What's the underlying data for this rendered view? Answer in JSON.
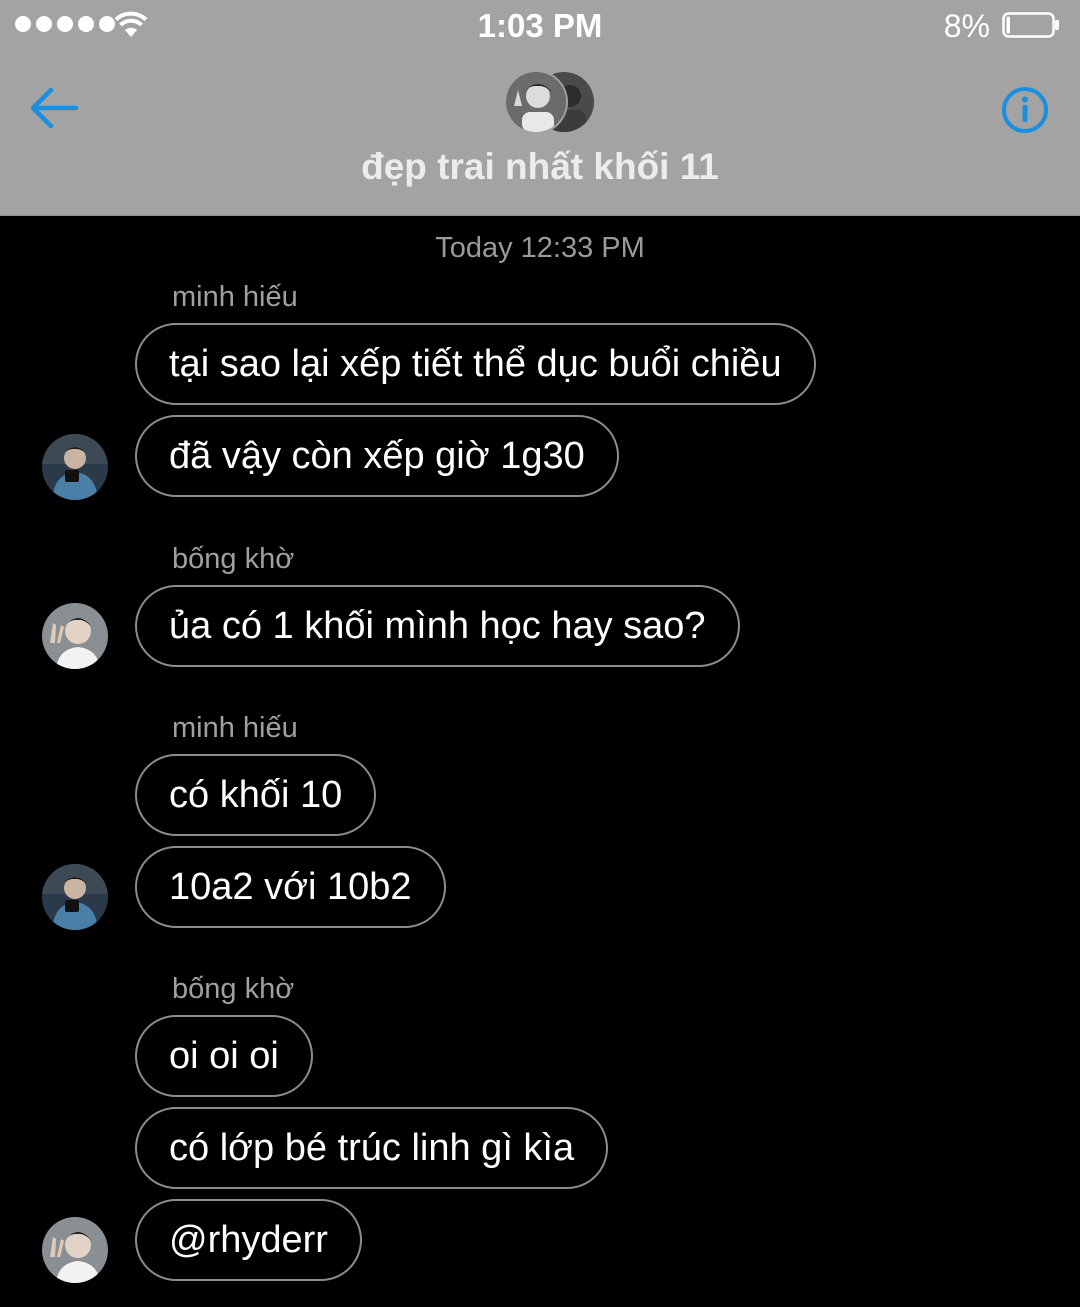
{
  "status_bar": {
    "time": "1:03 PM",
    "battery_percent": "8%",
    "battery_level": 0.08,
    "signal_dots": 5,
    "wifi_icon": "wifi-icon",
    "battery_icon": "battery-icon"
  },
  "nav": {
    "title": "đẹp trai nhất khối 11",
    "back_icon": "arrow-left-icon",
    "info_icon": "info-icon",
    "accent_color": "#1a8fe0"
  },
  "conversation": {
    "timestamp": "Today 12:33 PM",
    "groups": [
      {
        "sender": "minh hiếu",
        "messages": [
          "tại sao lại xếp tiết thể dục buổi chiều",
          "đã vậy còn xếp giờ 1g30"
        ]
      },
      {
        "sender": "bống khờ",
        "messages": [
          "ủa có 1 khối mình học hay sao?"
        ]
      },
      {
        "sender": "minh hiếu",
        "messages": [
          "có khối 10",
          "10a2 với 10b2"
        ]
      },
      {
        "sender": "bống khờ",
        "messages": [
          "oi oi oi",
          "có lớp bé trúc linh gì kìa",
          "@rhyderr"
        ]
      }
    ]
  },
  "colors": {
    "header_bg": "#a3a3a3",
    "background": "#000000",
    "bubble_border": "#8c8c8c",
    "sender_text": "#a0a0a0"
  }
}
